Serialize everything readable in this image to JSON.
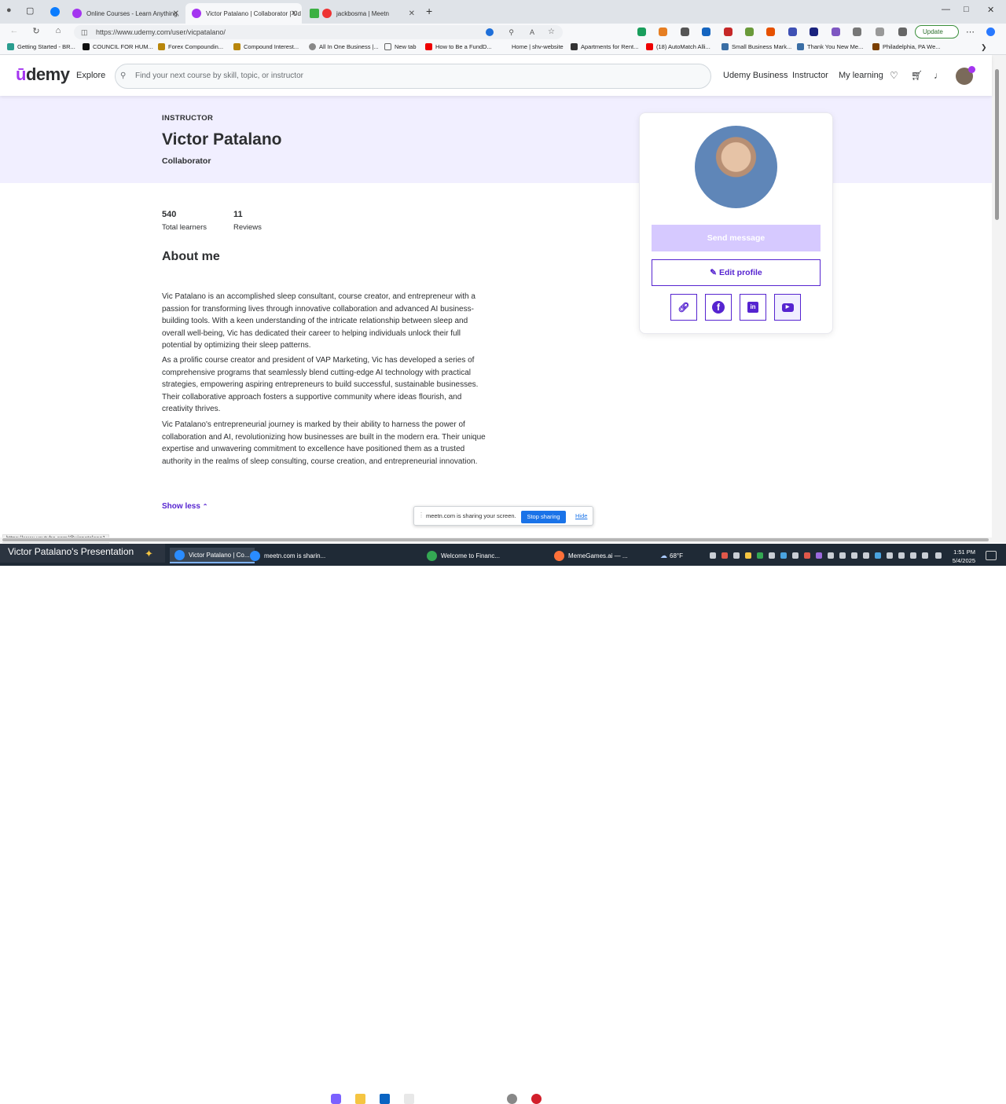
{
  "browser": {
    "tabs": [
      {
        "label": "Online Courses - Learn Anything,",
        "active": false
      },
      {
        "label": "Victor Patalano | Collaborator | Ud",
        "active": true
      },
      {
        "label": "jackbosma | Meetn",
        "active": false
      }
    ],
    "url": "https://www.udemy.com/user/vicpatalano/",
    "update_label": "Update",
    "bookmarks": [
      "Getting Started - BR...",
      "COUNCIL FOR HUM...",
      "Forex Compoundin...",
      "Compound Interest...",
      "All In One Business |...",
      "New tab",
      "How to Be a FundD...",
      "Home | shv-website",
      "Apartments for Rent...",
      "(18) AutoMatch Alli...",
      "Small Business Mark...",
      "Thank You New Me...",
      "Philadelphia, PA We..."
    ]
  },
  "header": {
    "logo": "udemy",
    "explore": "Explore",
    "search_placeholder": "Find your next course by skill, topic, or instructor",
    "links": [
      "Udemy Business",
      "Instructor",
      "My learning"
    ]
  },
  "profile": {
    "role": "INSTRUCTOR",
    "name": "Victor Patalano",
    "headline": "Collaborator",
    "stats": [
      {
        "value": "540",
        "label": "Total learners"
      },
      {
        "value": "11",
        "label": "Reviews"
      }
    ],
    "about_heading": "About me",
    "about_paragraphs": [
      "Vic Patalano is an accomplished sleep consultant, course creator, and entrepreneur with a passion for transforming lives through innovative collaboration and advanced AI business-building tools. With a keen understanding of the intricate relationship between sleep and overall well-being, Vic has dedicated their career to helping individuals unlock their full potential by optimizing their sleep patterns.",
      "As a prolific course creator and president of VAP Marketing, Vic has developed a series of comprehensive programs that seamlessly blend cutting-edge AI technology with practical strategies, empowering aspiring entrepreneurs to build successful, sustainable businesses. Their collaborative approach fosters a supportive community where ideas flourish, and creativity thrives.",
      "Vic Patalano's entrepreneurial journey is marked by their ability to harness the power of collaboration and AI, revolutionizing how businesses are built in the modern era. Their unique expertise and unwavering commitment to excellence have positioned them as a trusted authority in the realms of sleep consulting, course creation, and entrepreneurial innovation."
    ],
    "show_less": "Show less",
    "send_message": "Send message",
    "edit_profile": "Edit profile",
    "social_icons": [
      "link-icon",
      "facebook-icon",
      "linkedin-icon",
      "youtube-icon"
    ]
  },
  "screen_share": {
    "message": "meetn.com is sharing your screen.",
    "stop": "Stop sharing",
    "hide": "Hide"
  },
  "status_url": "https://www.youtube.com/@vicpatalano1",
  "taskbar": {
    "presentation": "Victor Patalano's Presentation",
    "items": [
      "Victor Patalano | Co...",
      "meetn.com is sharin...",
      "Welcome to Financ...",
      "MemeGames.ai — ..."
    ],
    "weather": "68°F",
    "time": "1:51 PM",
    "date": "5/4/2025"
  },
  "colors": {
    "brand": "#a435f0",
    "accent": "#5624d0",
    "hero_bg": "#f1efff"
  }
}
